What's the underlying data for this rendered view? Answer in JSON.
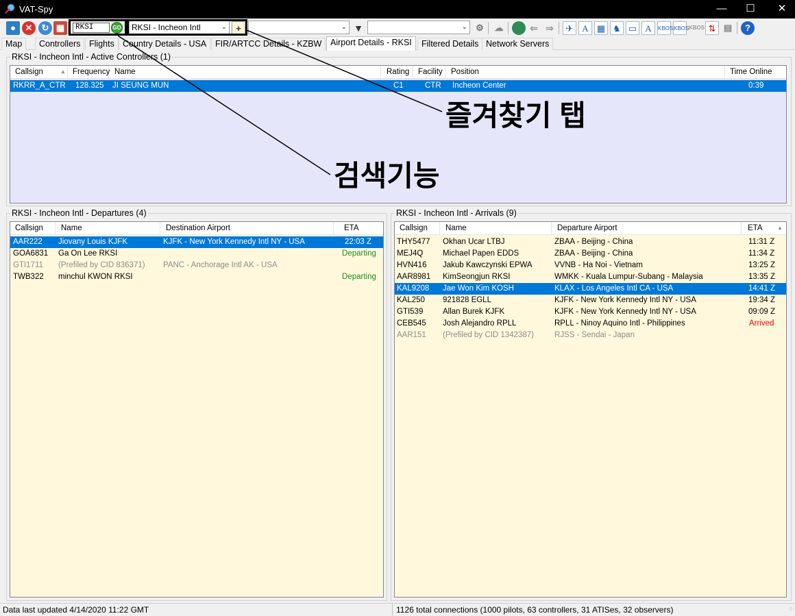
{
  "window": {
    "title": "VAT-Spy"
  },
  "toolbar": {
    "search_value": "RKSI",
    "go_label": "GO",
    "favorites_selected": "RKSI - Incheon Intl",
    "combo2_value": "",
    "combo3_value": ""
  },
  "tabs": [
    {
      "label": "Map"
    },
    {
      "label": "Controllers"
    },
    {
      "label": "Flights"
    },
    {
      "label": "Country Details - USA"
    },
    {
      "label": "FIR/ARTCC Details - KZBW"
    },
    {
      "label": "Airport Details - RKSI"
    },
    {
      "label": "Filtered Details"
    },
    {
      "label": "Network Servers"
    }
  ],
  "controllers": {
    "title": "RKSI - Incheon Intl - Active Controllers (1)",
    "headers": [
      "Callsign",
      "Frequency",
      "Name",
      "Rating",
      "Facility",
      "Position",
      "Time Online"
    ],
    "rows": [
      {
        "callsign": "RKRR_A_CTR",
        "frequency": "128.325",
        "name": "JI SEUNG MUN",
        "rating": "C1",
        "facility": "CTR",
        "position": "Incheon Center",
        "time": "0:39"
      }
    ]
  },
  "departures": {
    "title": "RKSI - Incheon Intl - Departures (4)",
    "headers": [
      "Callsign",
      "Name",
      "Destination Airport",
      "ETA"
    ],
    "rows": [
      {
        "callsign": "AAR222",
        "name": "Jiovany Louis KJFK",
        "airport": "KJFK - New York Kennedy Intl NY - USA",
        "eta": "22:03 Z"
      },
      {
        "callsign": "GOA6831",
        "name": "Ga On Lee RKSI",
        "airport": "",
        "eta": "Departing"
      },
      {
        "callsign": "GTI1711",
        "name": "(Prefiled by CID 836371)",
        "airport": "PANC - Anchorage Intl AK - USA",
        "eta": ""
      },
      {
        "callsign": "TWB322",
        "name": "minchul KWON RKSI",
        "airport": "",
        "eta": "Departing"
      }
    ]
  },
  "arrivals": {
    "title": "RKSI - Incheon Intl - Arrivals (9)",
    "headers": [
      "Callsign",
      "Name",
      "Departure Airport",
      "ETA"
    ],
    "rows": [
      {
        "callsign": "THY5477",
        "name": "Okhan Ucar LTBJ",
        "airport": "ZBAA - Beijing - China",
        "eta": "11:31 Z"
      },
      {
        "callsign": "MEJ4Q",
        "name": "Michael Papen EDDS",
        "airport": "ZBAA - Beijing - China",
        "eta": "11:34 Z"
      },
      {
        "callsign": "HVN416",
        "name": "Jakub Kawczynski EPWA",
        "airport": "VVNB - Ha Noi - Vietnam",
        "eta": "13:25 Z"
      },
      {
        "callsign": "AAR8981",
        "name": "KimSeongjun RKSI",
        "airport": "WMKK - Kuala Lumpur-Subang - Malaysia",
        "eta": "13:35 Z"
      },
      {
        "callsign": "KAL9208",
        "name": "Jae Won Kim KOSH",
        "airport": "KLAX - Los Angeles Intl CA - USA",
        "eta": "14:41 Z"
      },
      {
        "callsign": "KAL250",
        "name": "921828 EGLL",
        "airport": "KJFK - New York Kennedy Intl NY - USA",
        "eta": "19:34 Z"
      },
      {
        "callsign": "GTI539",
        "name": "Allan Burek KJFK",
        "airport": "KJFK - New York Kennedy Intl NY - USA",
        "eta": "09:09 Z"
      },
      {
        "callsign": "CEB545",
        "name": "Josh Alejandro RPLL",
        "airport": "RPLL - Ninoy Aquino Intl - Philippines",
        "eta": "Arrived"
      },
      {
        "callsign": "AAR151",
        "name": "(Prefiled by CID 1342387)",
        "airport": "RJSS - Sendai - Japan",
        "eta": ""
      }
    ]
  },
  "annotations": {
    "favorites": "즐겨찾기 탭",
    "search": "검색기능"
  },
  "status": {
    "left": "Data last updated 4/14/2020 11:22 GMT",
    "right": "1126 total connections (1000 pilots, 63 controllers, 31 ATISes, 32 observers)"
  },
  "colors": {
    "selection": "#0078d7",
    "list_bg_controllers": "#e6e6fa",
    "list_bg_flights": "#fff8dc",
    "departing": "#1e8c1e",
    "arrived": "#e00000"
  }
}
